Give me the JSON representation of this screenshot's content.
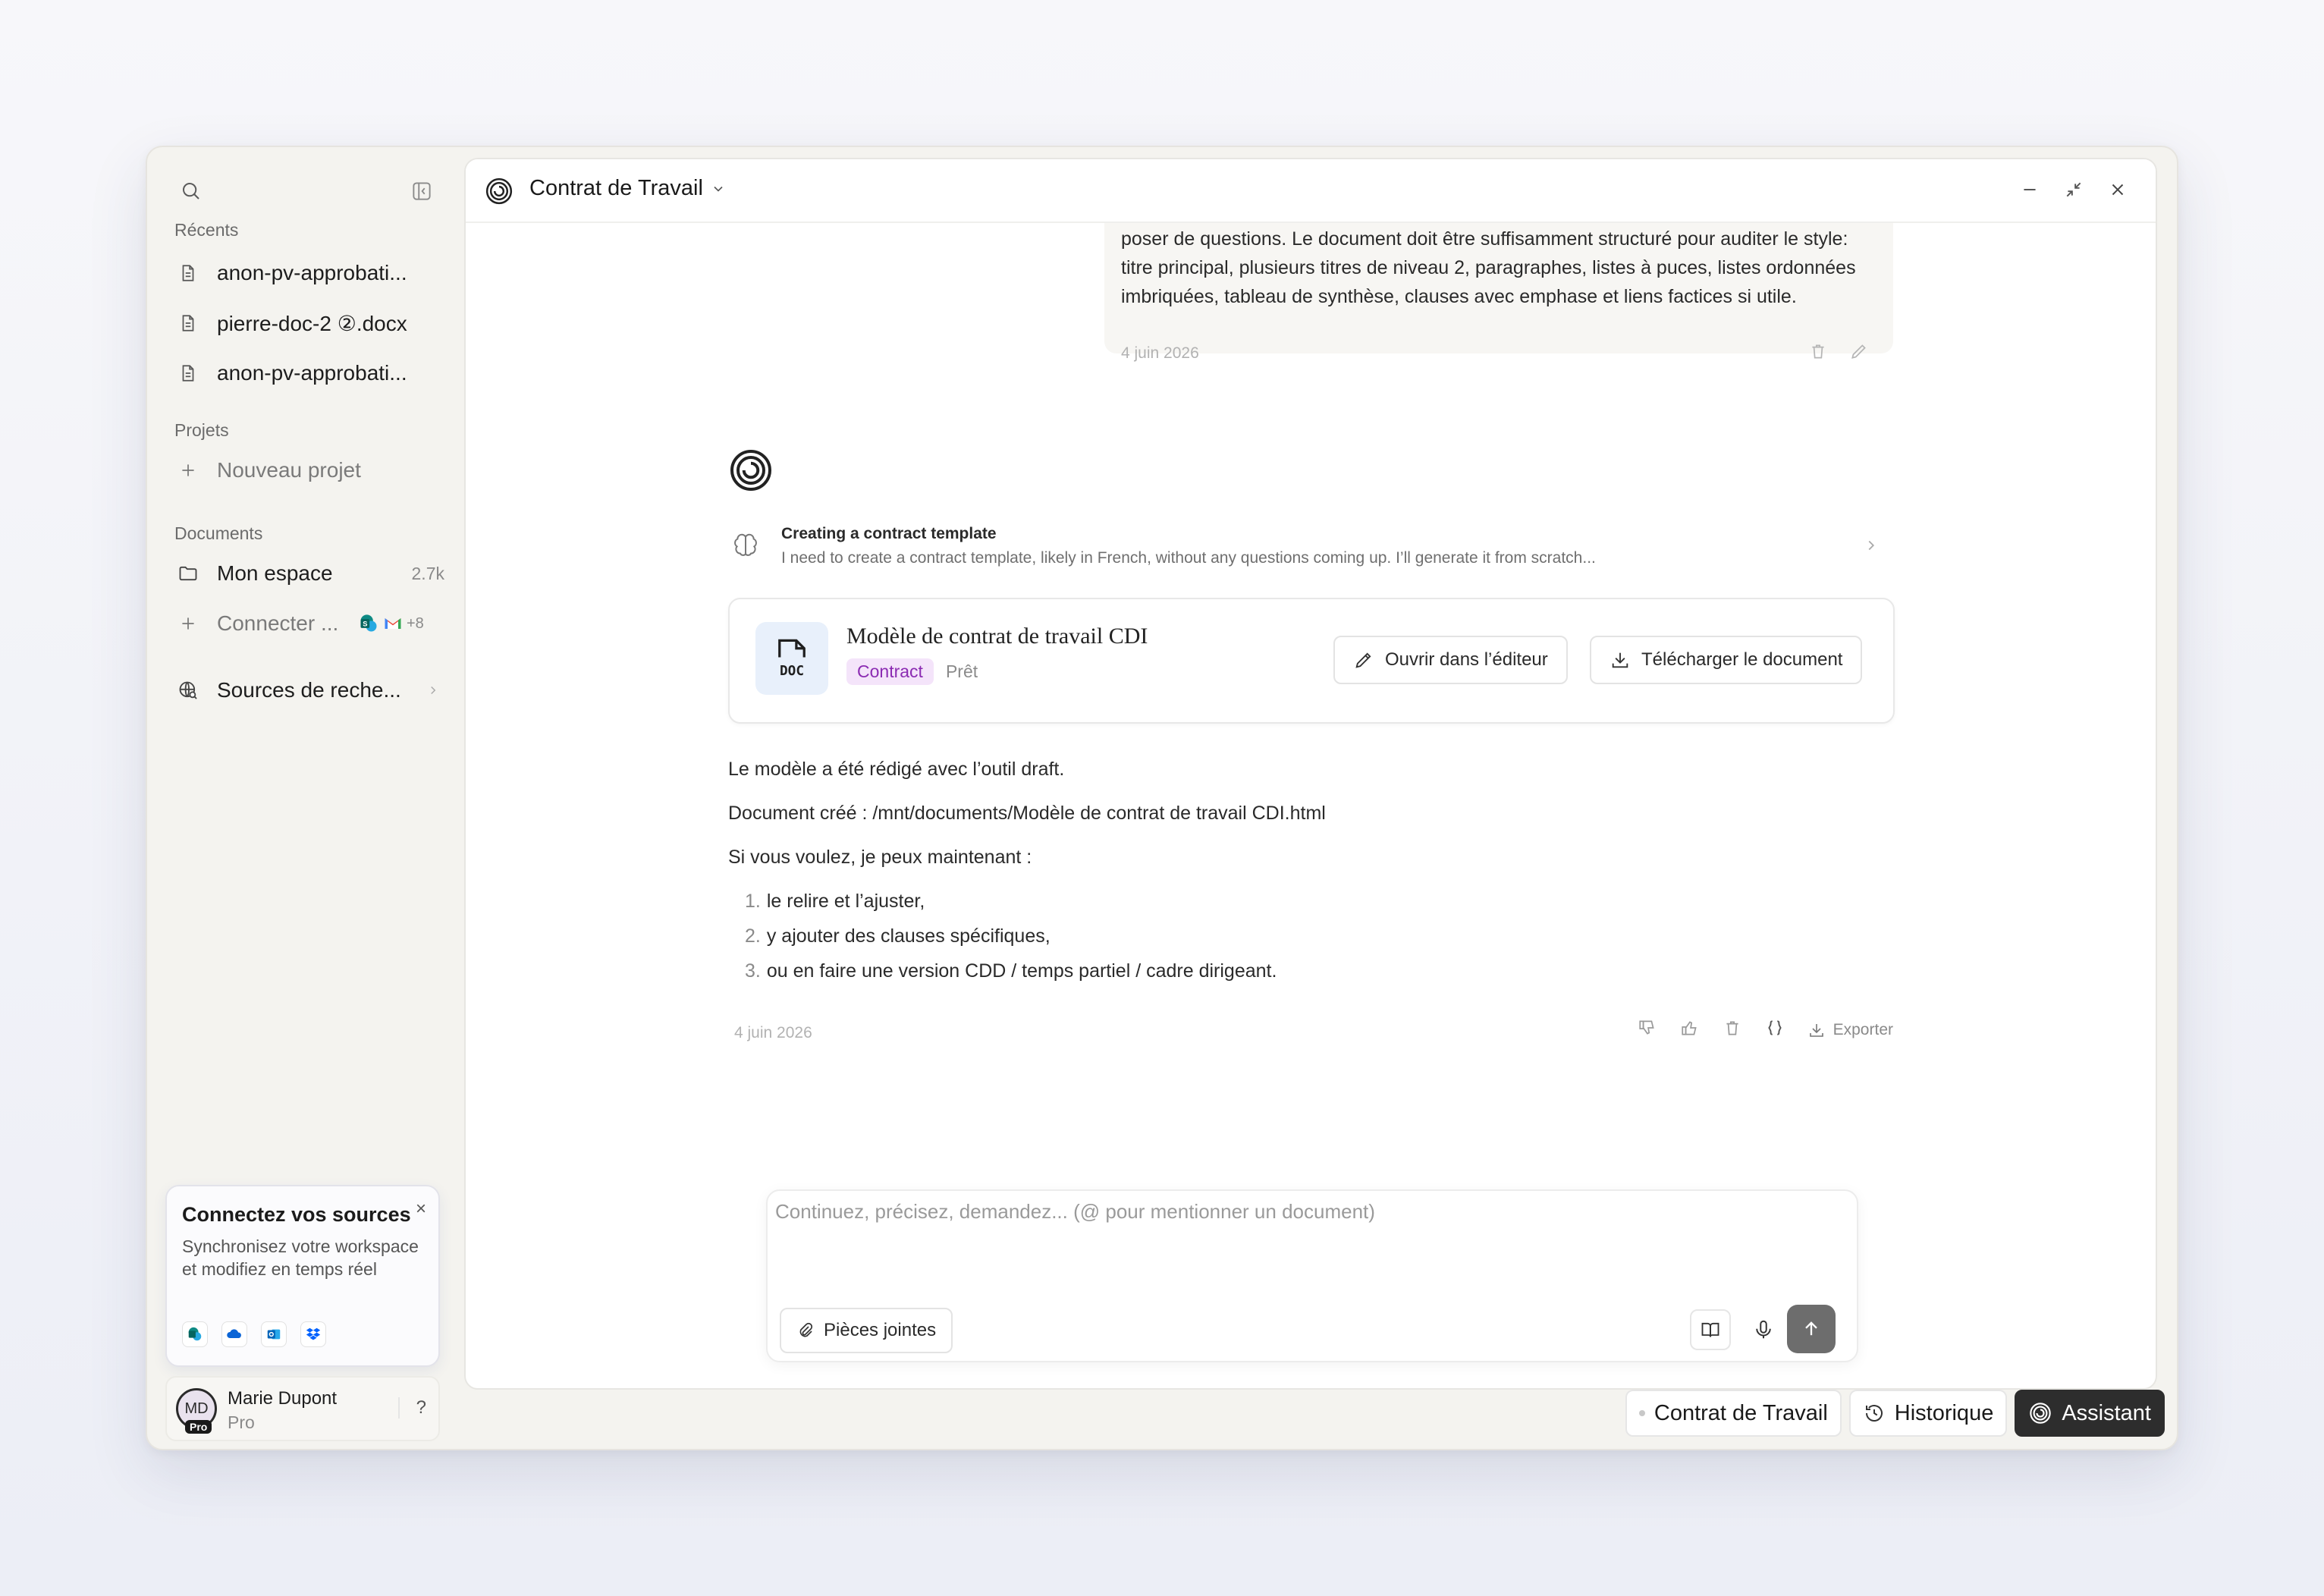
{
  "sidebar": {
    "recents_label": "Récents",
    "recents": [
      {
        "label": "anon-pv-approbati...",
        "icon": "file-icon"
      },
      {
        "label": "pierre-doc-2 ②.docx",
        "icon": "file-icon"
      },
      {
        "label": "anon-pv-approbati...",
        "icon": "file-icon"
      }
    ],
    "projects_label": "Projets",
    "new_project": "Nouveau projet",
    "documents_label": "Documents",
    "my_space": "Mon espace",
    "my_space_count": "2.7k",
    "connect": "Connecter ...",
    "connect_more": "+8",
    "research_sources": "Sources de reche...",
    "promo": {
      "title": "Connectez vos sources",
      "close": "×",
      "text": "Synchronisez votre workspace et modifiez en temps réel",
      "icons": [
        "sharepoint-icon",
        "onedrive-icon",
        "outlook-icon",
        "dropbox-icon"
      ]
    },
    "user": {
      "initials": "MD",
      "name": "Marie Dupont",
      "plan": "Pro",
      "badge": "Pro",
      "help": "?"
    }
  },
  "panel": {
    "title": "Contrat de Travail",
    "user_message": {
      "text": "poser de questions. Le document doit être suffisamment structuré pour auditer le style: titre principal, plusieurs titres de niveau 2, paragraphes, listes à puces, listes ordonnées imbriquées, tableau de synthèse, clauses avec emphase et liens factices si utile.",
      "date": "4 juin 2026"
    },
    "thinking": {
      "title": "Creating a contract template",
      "summary": "I need to create a contract template, likely in French, without any questions coming up. I’ll generate it from scratch..."
    },
    "document": {
      "name": "Modèle de contrat de travail CDI",
      "thumb_label": "DOC",
      "tag": "Contract",
      "status": "Prêt",
      "open_label": "Ouvrir dans l’éditeur",
      "download_label": "Télécharger le document"
    },
    "reply": {
      "line1": "Le modèle a été rédigé avec l’outil draft.",
      "line2": "Document créé : /mnt/documents/Modèle de contrat de travail CDI.html",
      "line3": "Si vous voulez, je peux maintenant :",
      "list": [
        {
          "n": "1.",
          "text": "le relire et l’ajuster,"
        },
        {
          "n": "2.",
          "text": "y ajouter des clauses spécifiques,"
        },
        {
          "n": "3.",
          "text": "ou en faire une version CDD / temps partiel / cadre dirigeant."
        }
      ],
      "date": "4 juin 2026",
      "export_label": "Exporter"
    },
    "composer": {
      "placeholder": "Continuez, précisez, demandez... (@ pour mentionner un document)",
      "value": "",
      "attach_label": "Pièces jointes"
    }
  },
  "bottom_tabs": {
    "document": "Contrat de Travail",
    "history": "Historique",
    "assistant": "Assistant"
  },
  "colors": {
    "accent_tag_bg": "#f4e4fa",
    "accent_tag_text": "#8b2bb2",
    "send_button": "#6d6d6d",
    "assistant_tab": "#2d2d2d"
  }
}
